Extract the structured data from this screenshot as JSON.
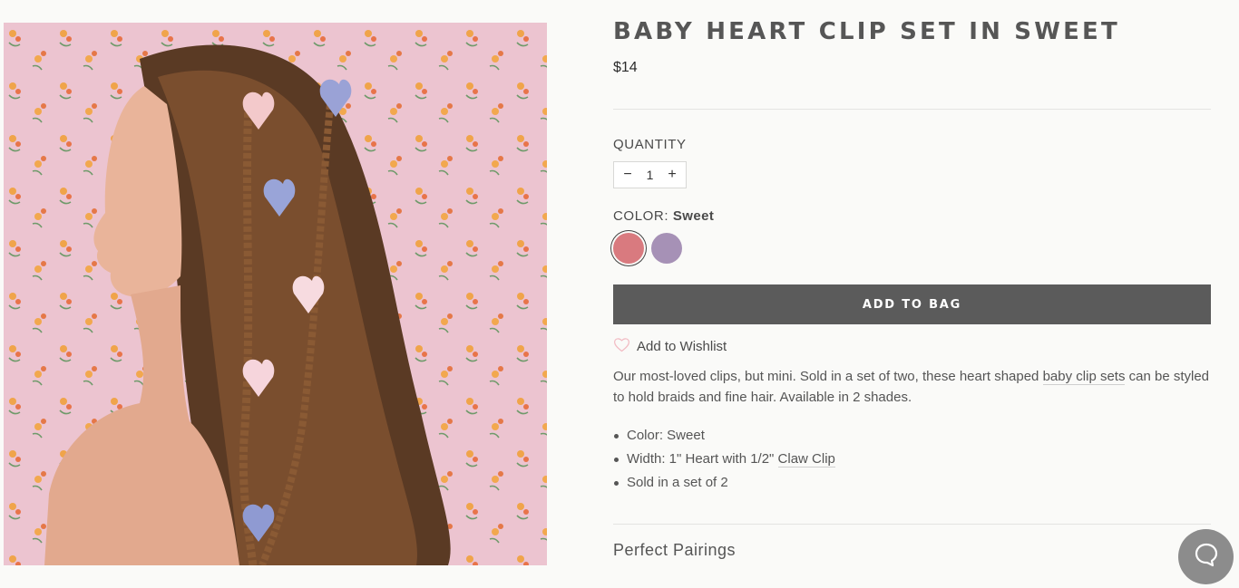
{
  "product": {
    "title": "BABY HEART CLIP SET IN SWEET",
    "price": "$14"
  },
  "quantity": {
    "label": "QUANTITY",
    "value": "1",
    "decrement": "−",
    "increment": "+"
  },
  "color": {
    "label": "COLOR:",
    "selected": "Sweet",
    "swatches": [
      {
        "name": "Sweet",
        "hex": "#d97a7f"
      },
      {
        "name": "Lilac",
        "hex": "#a691b6"
      }
    ]
  },
  "cta": {
    "add_to_bag": "ADD TO BAG"
  },
  "wishlist": {
    "label": "Add to Wishlist"
  },
  "description": {
    "before_link": "Our most-loved clips, but mini. Sold in a set of two, these heart shaped ",
    "link": "baby clip sets",
    "after_link": " can be styled to hold braids and fine hair. Available in 2 shades."
  },
  "bullets": {
    "color": "Color: Sweet",
    "width_before": "Width: 1\" Heart with 1/2\" ",
    "width_link": "Claw Clip",
    "set": "Sold in a set of 2"
  },
  "pairings": {
    "label": "Perfect Pairings"
  },
  "colors": {
    "accent_button": "#5b5b5b",
    "background": "#fafaf8",
    "chat": "#8c8c8c"
  }
}
